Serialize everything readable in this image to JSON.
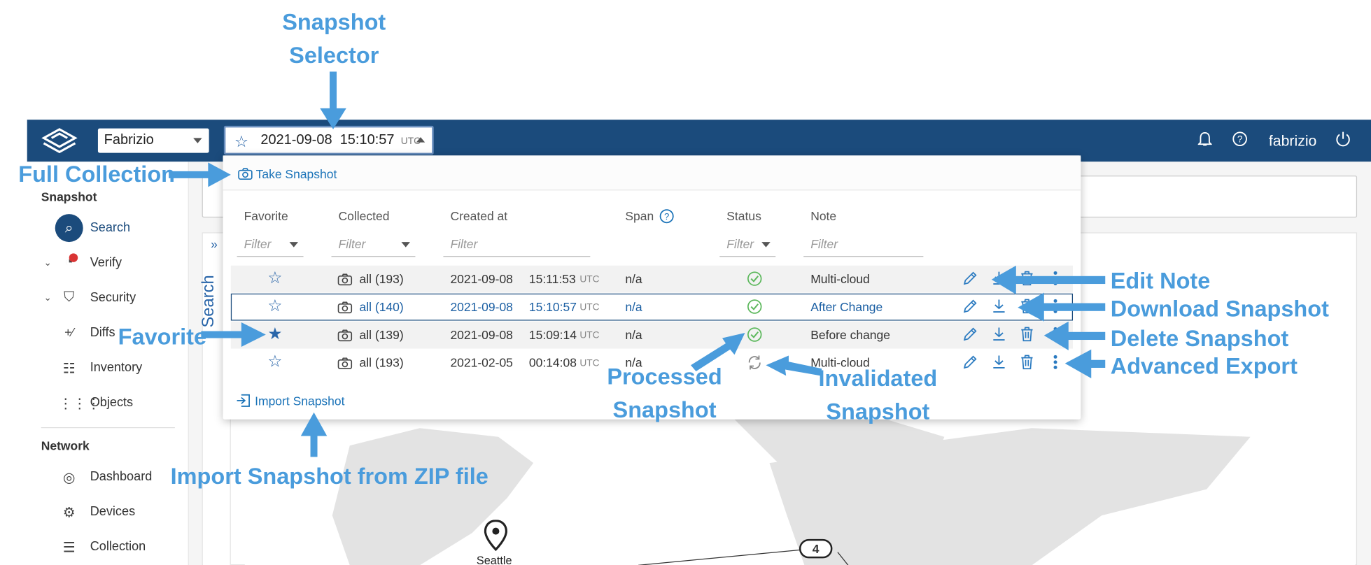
{
  "header": {
    "space": "Fabrizio",
    "snapshot_date": "2021-09-08",
    "snapshot_time": "15:10:57",
    "snapshot_tz": "UTC",
    "user": "fabrizio"
  },
  "sidebar": {
    "section_snapshot": "Snapshot",
    "items_snapshot": [
      "Search",
      "Verify",
      "Security",
      "Diffs",
      "Inventory",
      "Objects"
    ],
    "section_network": "Network",
    "items_network": [
      "Dashboard",
      "Devices",
      "Collection"
    ]
  },
  "main": {
    "vertical_tab": "Search",
    "map_labels": {
      "city": "Seattle",
      "cluster": "4"
    }
  },
  "dropdown": {
    "take_snapshot": "Take Snapshot",
    "import_snapshot": "Import Snapshot",
    "columns": {
      "favorite": "Favorite",
      "collected": "Collected",
      "created": "Created at",
      "span": "Span",
      "status": "Status",
      "note": "Note"
    },
    "filter_placeholder": "Filter",
    "rows": [
      {
        "collected": "all (193)",
        "date": "2021-09-08",
        "time": "15:11:53",
        "tz": "UTC",
        "span": "n/a",
        "status": "processed",
        "note": "Multi-cloud",
        "favorite": false
      },
      {
        "collected": "all (140)",
        "date": "2021-09-08",
        "time": "15:10:57",
        "tz": "UTC",
        "span": "n/a",
        "status": "processed",
        "note": "After Change",
        "favorite": false
      },
      {
        "collected": "all (139)",
        "date": "2021-09-08",
        "time": "15:09:14",
        "tz": "UTC",
        "span": "n/a",
        "status": "processed",
        "note": "Before change",
        "favorite": true
      },
      {
        "collected": "all (193)",
        "date": "2021-02-05",
        "time": "00:14:08",
        "tz": "UTC",
        "span": "n/a",
        "status": "invalidated",
        "note": "Multi-cloud",
        "favorite": false
      }
    ]
  },
  "annotations": {
    "snapshot_selector": [
      "Snapshot",
      "Selector"
    ],
    "full_collection": "Full Collection",
    "favorite": "Favorite",
    "edit_note": "Edit Note",
    "download_snapshot": "Download Snapshot",
    "delete_snapshot": "Delete Snapshot",
    "advanced_export": "Advanced Export",
    "processed_snapshot": [
      "Processed",
      "Snapshot"
    ],
    "invalidated_snapshot": [
      "Invalidated",
      "Snapshot"
    ],
    "import_zip": "Import Snapshot from ZIP file"
  },
  "colors": {
    "header": "#1b4b7c",
    "annotation": "#4a9cdc",
    "status_ok": "#5cb85c",
    "accent": "#2a66a9"
  },
  "icons": [
    "app-logo-icon",
    "star-icon",
    "bell-icon",
    "help-icon",
    "power-icon",
    "camera-icon",
    "import-icon",
    "pencil-icon",
    "download-icon",
    "trash-icon",
    "kebab-icon",
    "check-circle-icon",
    "refresh-icon"
  ]
}
